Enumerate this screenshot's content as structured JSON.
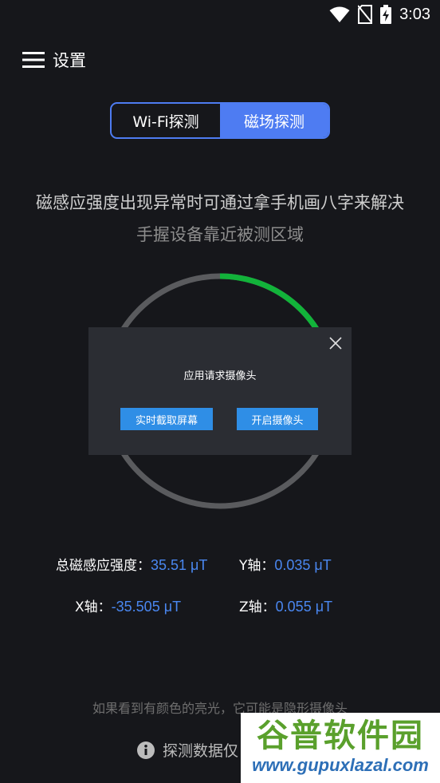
{
  "status_bar": {
    "time": "3:03"
  },
  "header": {
    "title": "设置"
  },
  "tabs": [
    {
      "label": "Wi-Fi探测",
      "active": false
    },
    {
      "label": "磁场探测",
      "active": true
    }
  ],
  "tip": {
    "line1": "磁感应强度出现异常时可通过拿手机画八字来解决",
    "line2": "手握设备靠近被测区域"
  },
  "gauge": {
    "level_fraction": 0.2,
    "track_color": "#5a5b5e",
    "fill_color": "#12b33a"
  },
  "stats": {
    "total": {
      "label": "总磁感应强度：",
      "value": "35.51 μT"
    },
    "y": {
      "label": "Y轴：",
      "value": "0.035 μT"
    },
    "x": {
      "label": "X轴：",
      "value": "-35.505 μT"
    },
    "z": {
      "label": "Z轴：",
      "value": "0.055 μT"
    }
  },
  "hint": "如果看到有颜色的亮光，它可能是隐形摄像头",
  "note": "探测数据仅",
  "modal": {
    "title": "应用请求摄像头",
    "buttons": {
      "screenshot": "实时截取屏幕",
      "camera": "开启摄像头"
    }
  },
  "watermark": {
    "name": "谷普软件园",
    "url": "www.gupuxlazal.com"
  },
  "colors": {
    "accent": "#4e7cf2",
    "value_blue": "#4a87f0",
    "button_blue": "#2f8ee6",
    "background": "#16171b"
  }
}
